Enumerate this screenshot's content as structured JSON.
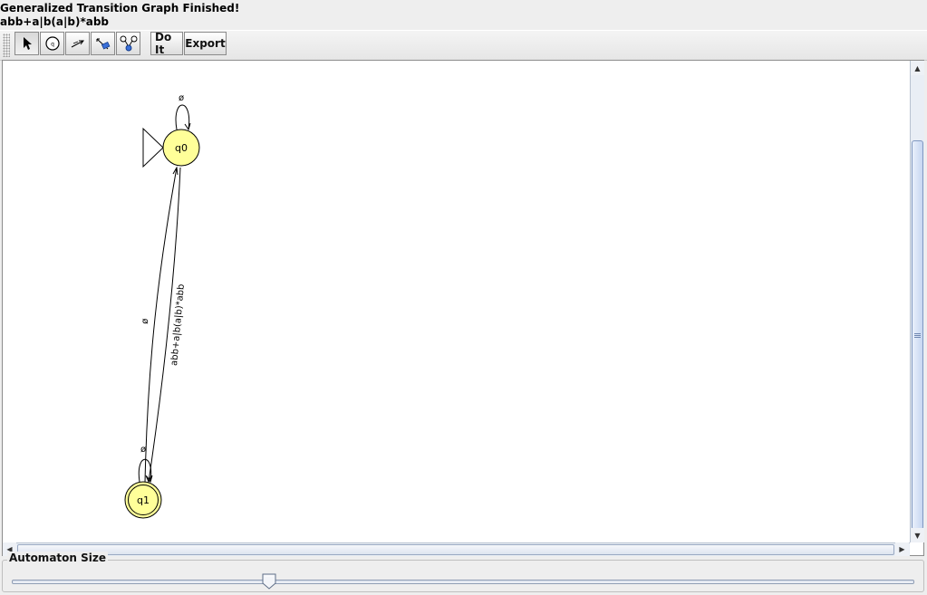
{
  "status": {
    "title": "Generalized Transition Graph Finished!",
    "expression": "abb+a|b(a|b)*abb"
  },
  "toolbar": {
    "tools": [
      {
        "name": "attribute-editor-tool",
        "icon": "arrow-pointer-icon",
        "active": true
      },
      {
        "name": "state-creator-tool",
        "icon": "state-circle-icon",
        "active": false
      },
      {
        "name": "transition-creator-tool",
        "icon": "transition-arrow-icon",
        "active": false
      },
      {
        "name": "deleter-tool",
        "icon": "delete-tool-icon",
        "active": false
      },
      {
        "name": "collapse-tool",
        "icon": "collapse-states-icon",
        "active": false
      }
    ],
    "do_it_label": "Do It",
    "export_label": "Export"
  },
  "graph": {
    "states": [
      {
        "id": "q0",
        "label": "q0",
        "initial": true,
        "final": false
      },
      {
        "id": "q1",
        "label": "q1",
        "initial": false,
        "final": true
      }
    ],
    "transitions": [
      {
        "from": "q0",
        "to": "q0",
        "label": "ø"
      },
      {
        "from": "q1",
        "to": "q0",
        "label": "ø"
      },
      {
        "from": "q0",
        "to": "q1",
        "label": "abb+a|b(a|b)*abb"
      },
      {
        "from": "q1",
        "to": "q1",
        "label": "ø"
      }
    ],
    "colors": {
      "state_fill": "#ffff99",
      "state_stroke": "#000000",
      "edge": "#000000"
    }
  },
  "automaton_size": {
    "label": "Automaton Size",
    "value_fraction": 0.285
  }
}
